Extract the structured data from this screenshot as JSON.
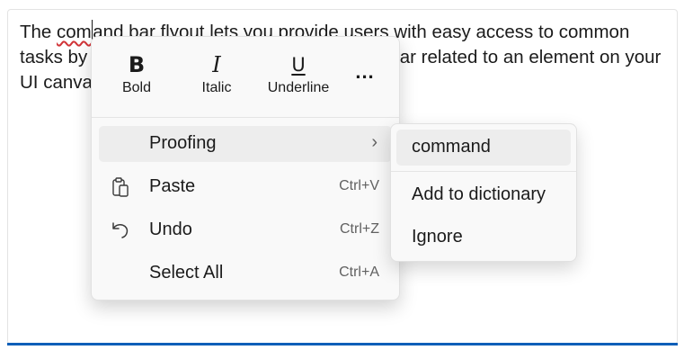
{
  "editor": {
    "text_before": "The ",
    "misspelled": "comand",
    "misspelled_a": "com",
    "misspelled_b": "and",
    "text_after": " bar flyout lets you provide users with easy access to common tasks by showing commands in a floating toolbar related to an element on your UI canvas."
  },
  "toolbar": {
    "bold_glyph": "B",
    "bold_label": "Bold",
    "italic_glyph": "I",
    "italic_label": "Italic",
    "underline_glyph": "U",
    "underline_label": "Underline",
    "more_glyph": "..."
  },
  "menu": {
    "items": [
      {
        "label": "Proofing",
        "accel": "",
        "icon": "none",
        "has_submenu": true
      },
      {
        "label": "Paste",
        "accel": "Ctrl+V",
        "icon": "paste-icon"
      },
      {
        "label": "Undo",
        "accel": "Ctrl+Z",
        "icon": "undo-icon"
      },
      {
        "label": "Select All",
        "accel": "Ctrl+A",
        "icon": "none"
      }
    ]
  },
  "submenu": {
    "items": [
      {
        "label": "command"
      },
      {
        "label": "Add to dictionary"
      },
      {
        "label": "Ignore"
      }
    ]
  },
  "colors": {
    "accent": "#0f5fb8",
    "spellcheck": "#d13438"
  }
}
